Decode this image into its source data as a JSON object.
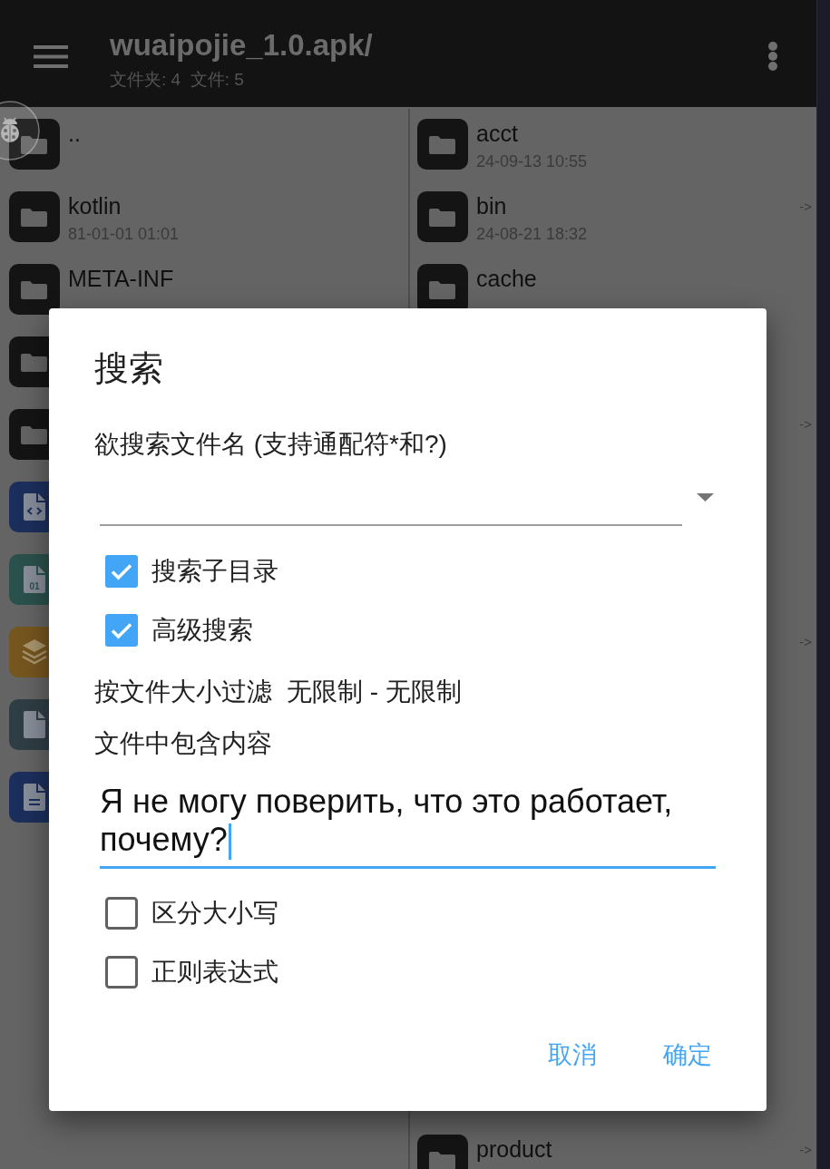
{
  "toolbar": {
    "title": "wuaipojie_1.0.apk/",
    "subtitle": "文件夹: 4  文件: 5"
  },
  "left_panel": {
    "items": [
      {
        "kind": "folder",
        "name": ".."
      },
      {
        "kind": "folder",
        "name": "kotlin",
        "date": "81-01-01 01:01"
      },
      {
        "kind": "folder",
        "name": "META-INF"
      },
      {
        "kind": "folder"
      },
      {
        "kind": "folder"
      },
      {
        "kind": "code"
      },
      {
        "kind": "binary",
        "icon_text": "01"
      },
      {
        "kind": "layers"
      },
      {
        "kind": "file"
      },
      {
        "kind": "document"
      }
    ]
  },
  "right_panel": {
    "items": [
      {
        "kind": "folder",
        "name": "acct",
        "date": "24-09-13 10:55"
      },
      {
        "kind": "folder",
        "name": "bin",
        "date": "24-08-21 18:32",
        "arrow": "->"
      },
      {
        "kind": "folder",
        "name": "cache"
      }
    ],
    "covered_row_arrows": [
      "->",
      "->"
    ],
    "bottom_items": [
      {
        "kind": "folder",
        "name": "product",
        "arrow": "->"
      }
    ]
  },
  "dialog": {
    "title": "搜索",
    "filename_label": "欲搜索文件名 (支持通配符*和?)",
    "options": [
      {
        "label": "搜索子目录",
        "checked": true
      },
      {
        "label": "高级搜索",
        "checked": true
      }
    ],
    "size_filter": {
      "label": "按文件大小过滤",
      "value": "无限制 - 无限制"
    },
    "content_label": "文件中包含内容",
    "content_input": {
      "value": "Я не могу поверить, что это работает, почему?",
      "focused": true
    },
    "match_options": [
      {
        "label": "区分大小写",
        "checked": false
      },
      {
        "label": "正则表达式",
        "checked": false
      }
    ],
    "buttons": [
      "取消",
      "确定"
    ]
  }
}
